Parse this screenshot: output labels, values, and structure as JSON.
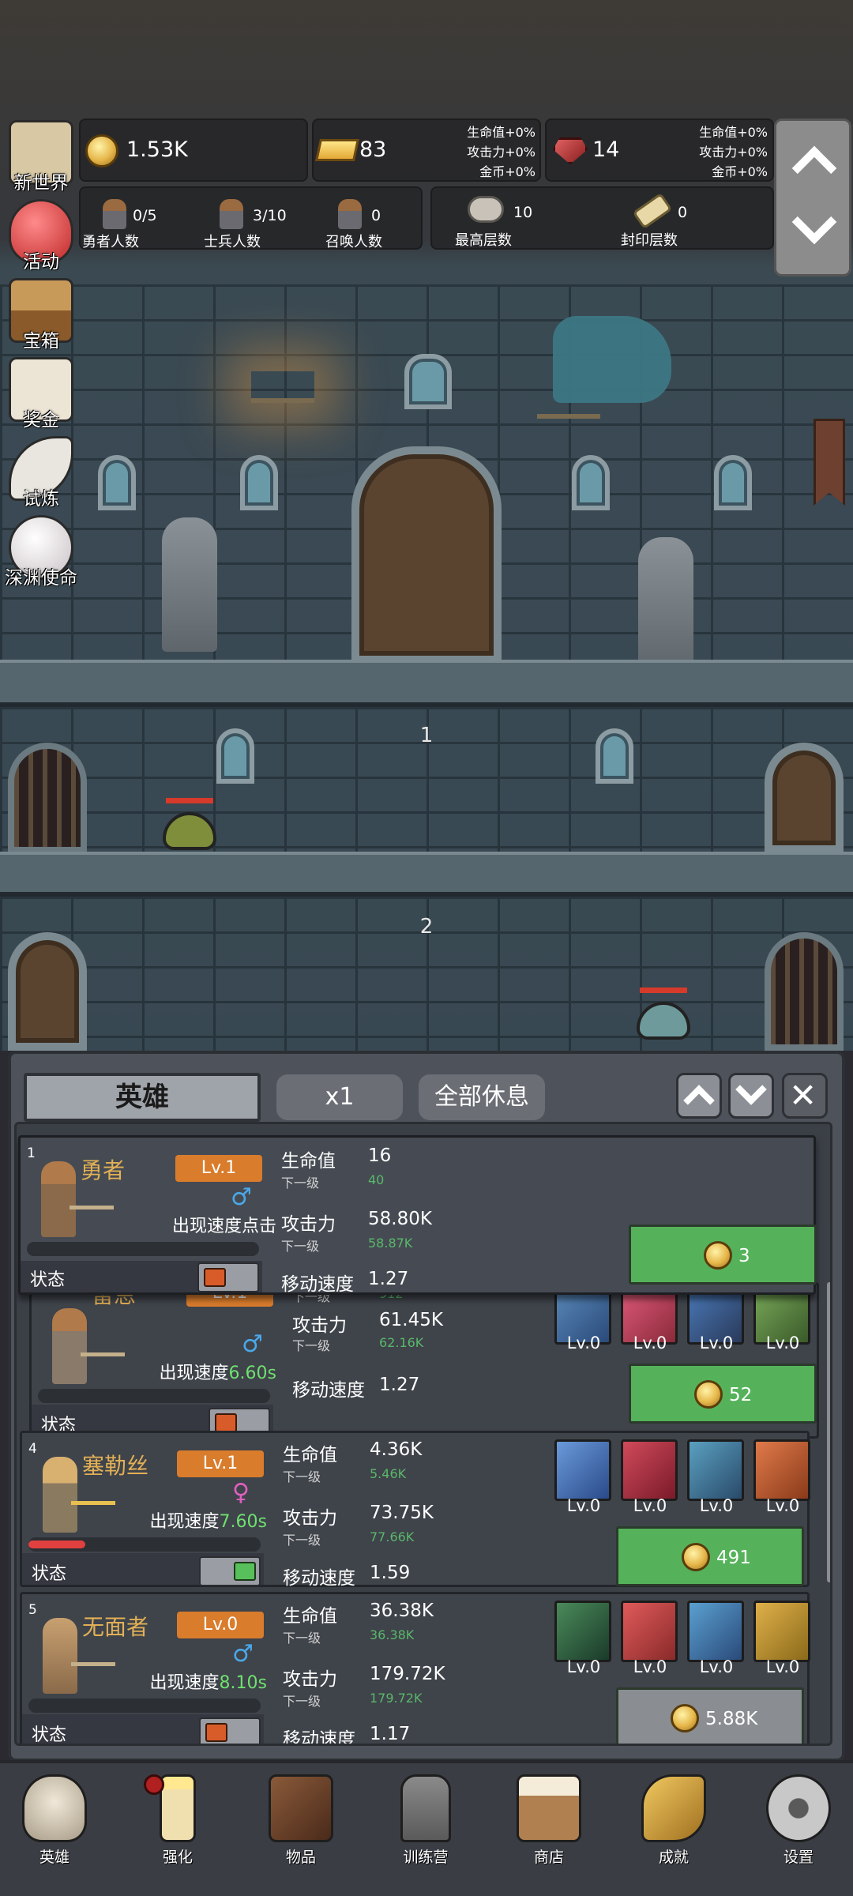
{
  "resources": {
    "gold": "1.53K",
    "bars": "83",
    "gems": "14",
    "bars_bonus": [
      "生命值+0%",
      "攻击力+0%",
      "金币+0%"
    ],
    "gems_bonus": [
      "生命值+0%",
      "攻击力+0%",
      "金币+0%"
    ]
  },
  "counts": {
    "heroes": {
      "value": "0/5",
      "label": "勇者人数"
    },
    "soldiers": {
      "value": "3/10",
      "label": "士兵人数"
    },
    "summons": {
      "value": "0",
      "label": "召唤人数"
    },
    "max_floor": {
      "value": "10",
      "label": "最高层数"
    },
    "seal_floor": {
      "value": "0",
      "label": "封印层数"
    }
  },
  "side_menu": [
    {
      "label": "新世界",
      "icon": "map-icon"
    },
    {
      "label": "活动",
      "icon": "heart-icon"
    },
    {
      "label": "宝箱",
      "icon": "chest-icon"
    },
    {
      "label": "奖金",
      "icon": "envelope-icon"
    },
    {
      "label": "试炼",
      "icon": "feather-icon"
    },
    {
      "label": "深渊使命",
      "icon": "pearl-icon"
    }
  ],
  "floors": [
    "1",
    "2"
  ],
  "panel": {
    "title": "英雄",
    "multiplier": "x1",
    "rest_all": "全部休息"
  },
  "heroes": [
    {
      "index": "1",
      "name": "勇者",
      "level": "Lv.1",
      "gender": "♂",
      "speed_label": "出现速度点击",
      "speed_value": "",
      "hp": "16",
      "hp_next": "40",
      "atk": "58.80K",
      "atk_next": "58.87K",
      "move": "1.27",
      "state_label": "状态",
      "active": false,
      "cost": "3"
    },
    {
      "index": "",
      "name": "雷恩",
      "level": "Lv.1",
      "gender": "♂",
      "speed_label": "出现速度",
      "speed_value": "6.60s",
      "hp_next": "912",
      "atk": "61.45K",
      "atk_next": "62.16K",
      "move": "1.27",
      "state_label": "状态",
      "active": false,
      "skills": [
        "Lv.0",
        "Lv.0",
        "Lv.0",
        "Lv.0"
      ],
      "cost": "52"
    },
    {
      "index": "4",
      "name": "塞勒丝",
      "level": "Lv.1",
      "gender": "♀",
      "speed_label": "出现速度",
      "speed_value": "7.60s",
      "hp": "4.36K",
      "hp_next": "5.46K",
      "atk": "73.75K",
      "atk_next": "77.66K",
      "move": "1.59",
      "state_label": "状态",
      "active": true,
      "skills": [
        "Lv.0",
        "Lv.0",
        "Lv.0",
        "Lv.0"
      ],
      "cost": "491"
    },
    {
      "index": "5",
      "name": "无面者",
      "level": "Lv.0",
      "gender": "♂",
      "speed_label": "出现速度",
      "speed_value": "8.10s",
      "hp": "36.38K",
      "hp_next": "36.38K",
      "atk": "179.72K",
      "atk_next": "179.72K",
      "move": "1.17",
      "state_label": "状态",
      "active": false,
      "skills": [
        "Lv.0",
        "Lv.0",
        "Lv.0",
        "Lv.0"
      ],
      "cost": "5.88K"
    }
  ],
  "stat_labels": {
    "hp": "生命值",
    "atk": "攻击力",
    "next": "下一级",
    "move": "移动速度"
  },
  "bottom_nav": [
    {
      "label": "英雄",
      "icon": "skull-icon"
    },
    {
      "label": "强化",
      "icon": "candle-icon"
    },
    {
      "label": "物品",
      "icon": "book-icon"
    },
    {
      "label": "训练营",
      "icon": "lantern-icon"
    },
    {
      "label": "商店",
      "icon": "beer-mug-icon"
    },
    {
      "label": "成就",
      "icon": "key-icon"
    },
    {
      "label": "设置",
      "icon": "gear-icon"
    }
  ],
  "colors": {
    "accent_orange": "#d97c2c",
    "buy_green": "#55b25a",
    "name_gold": "#e2b056",
    "male_blue": "#4aa8e8",
    "female_pink": "#e060c0"
  }
}
